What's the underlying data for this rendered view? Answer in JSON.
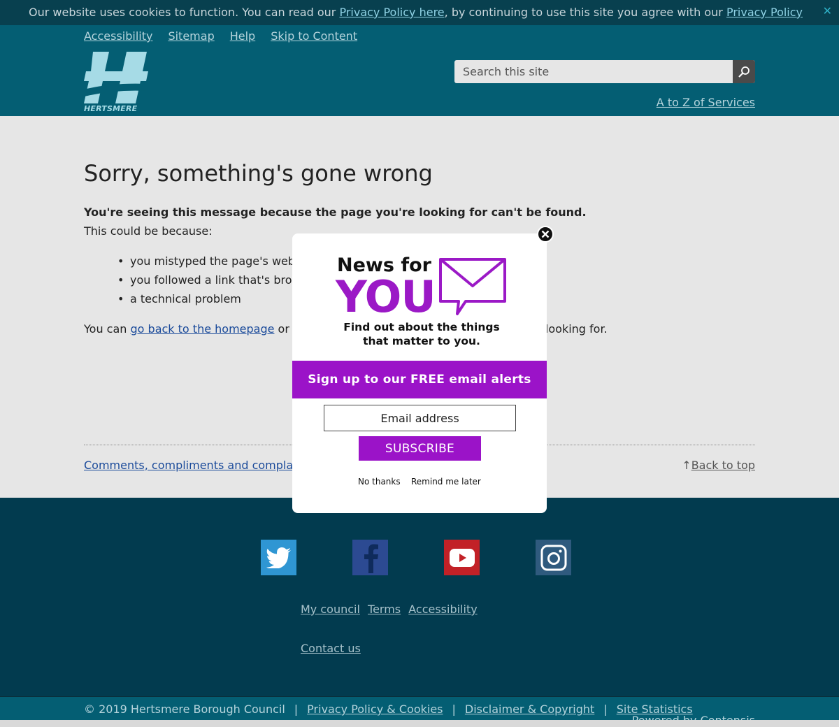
{
  "cookie_bar": {
    "text_before": "Our website uses cookies to function. You can read our ",
    "link1": "Privacy Policy here",
    "text_middle": ", by continuing to use this site you agree with our ",
    "link2": "Privacy Policy",
    "close_glyph": "✕"
  },
  "header": {
    "access_links": [
      "Accessibility",
      "Sitemap",
      "Help",
      "Skip to Content"
    ],
    "logo_text": "HERTSMERE",
    "search_placeholder": "Search this site",
    "atoz": "A to Z of Services"
  },
  "main": {
    "title": "Sorry, something's gone wrong",
    "lead": "You're seeing this message because the page you're looking for can't be found.",
    "could_be": "This could be because:",
    "reasons": [
      "you mistyped the page's web",
      "you followed a link that's bro",
      "a technical problem"
    ],
    "back_prefix": "You can ",
    "back_link": "go back to the homepage",
    "back_middle": " or",
    "back_tail": "e looking for.",
    "comments_link": "Comments, compliments and complaints",
    "back_top_arrow": "↑",
    "back_top": "Back to top"
  },
  "footer": {
    "social": [
      "twitter-icon",
      "facebook-icon",
      "youtube-icon",
      "instagram-icon"
    ],
    "links_row1": [
      "My council",
      "Terms",
      "Accessibility"
    ],
    "links_row2": [
      "Contact us"
    ]
  },
  "bottom_bar": {
    "copyright": "© 2019 Hertsmere Borough Council",
    "separator": "|",
    "links": [
      "Privacy Policy & Cookies",
      "Disclaimer & Copyright",
      "Site Statistics"
    ],
    "powered": "Powered by Contensis"
  },
  "modal": {
    "news_for": "News for",
    "you": "YOU",
    "tagline_1": "Find out about the things",
    "tagline_2": "that matter to you.",
    "signup": "Sign up to our FREE email alerts",
    "email_placeholder": "Email address",
    "subscribe": "SUBSCRIBE",
    "no_thanks": "No thanks",
    "remind_later": "Remind me later"
  },
  "colors": {
    "header_teal": "#045e73",
    "footer_navy": "#023b4f",
    "accent_purple": "#9b13c8",
    "link_blue": "#1a4a9a"
  }
}
